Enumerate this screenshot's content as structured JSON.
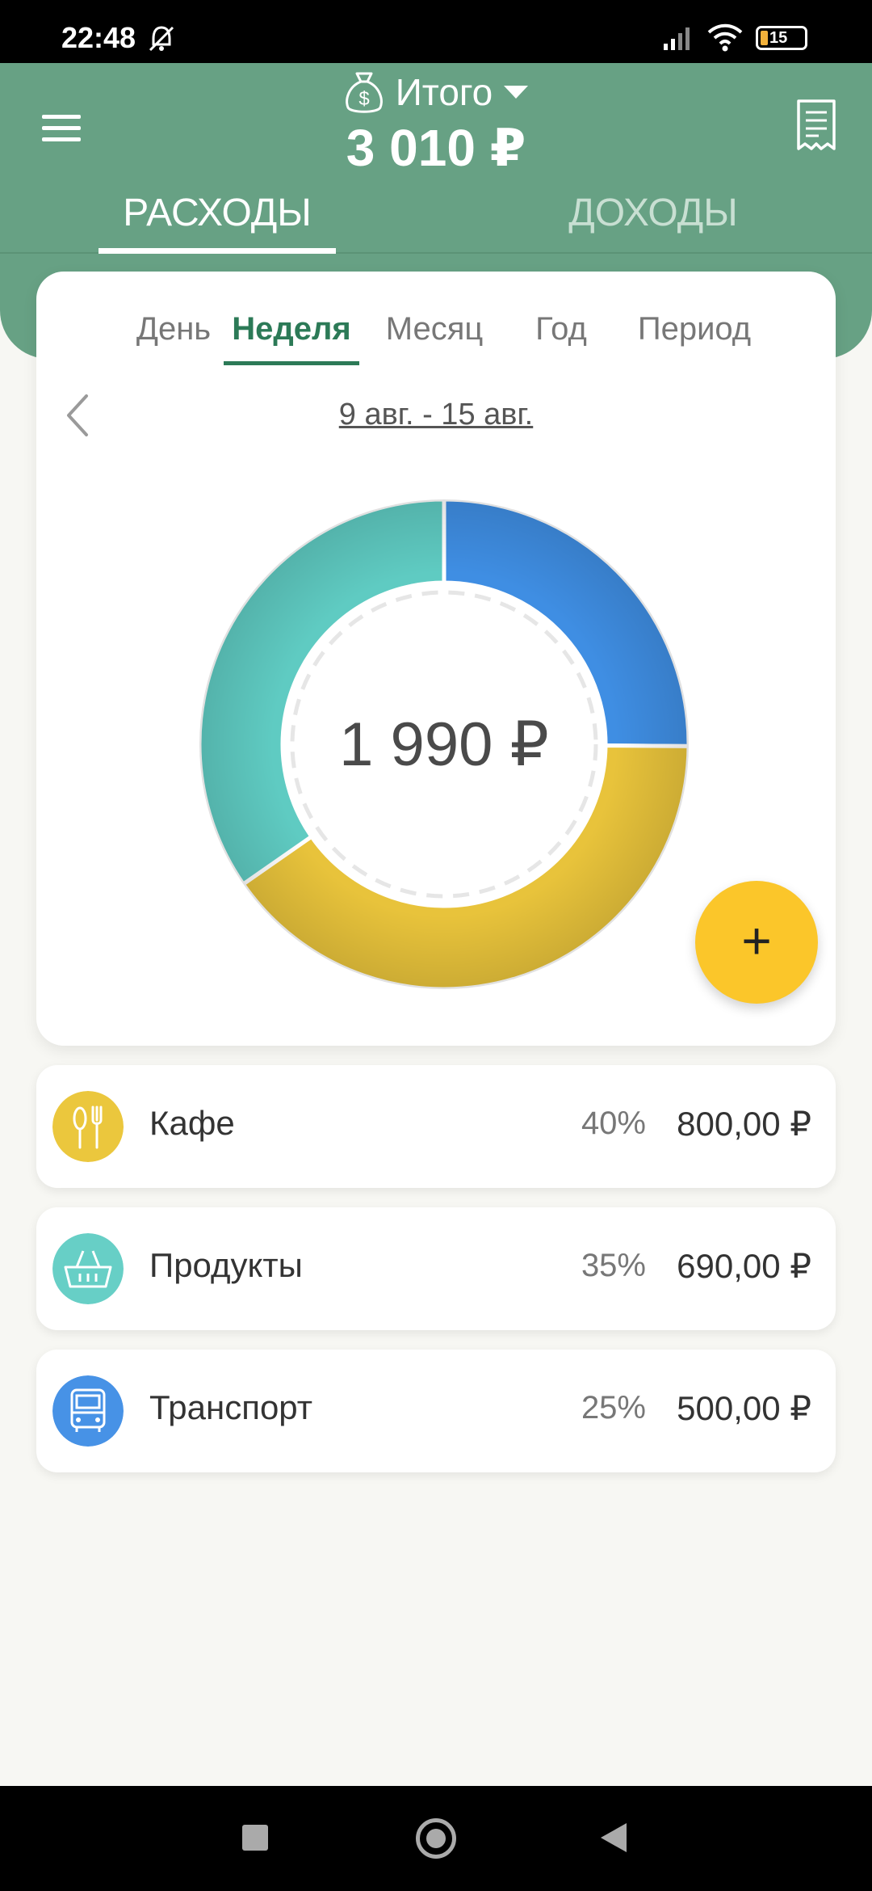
{
  "status_bar": {
    "time": "22:48",
    "battery": "15"
  },
  "header": {
    "wallet_title": "Итого",
    "total": "3 010 ₽",
    "tabs": {
      "expenses": "РАСХОДЫ",
      "income": "ДОХОДЫ"
    }
  },
  "period": {
    "tabs": [
      "День",
      "Неделя",
      "Месяц",
      "Год",
      "Период"
    ],
    "active": "Неделя",
    "range": "9 авг. - 15 авг."
  },
  "chart_data": {
    "type": "pie",
    "categories": [
      "Транспорт",
      "Кафе",
      "Продукты"
    ],
    "values": [
      500,
      800,
      690
    ],
    "colors": [
      "#3f8ee3",
      "#e8c33b",
      "#5fcbc2"
    ],
    "center_label": "1 990 ₽"
  },
  "fab": {
    "label": "+"
  },
  "categories": [
    {
      "name": "Кафе",
      "percent": "40%",
      "amount": "800,00 ₽",
      "icon": "fork-spoon-icon",
      "color": "#ebc73d"
    },
    {
      "name": "Продукты",
      "percent": "35%",
      "amount": "690,00 ₽",
      "icon": "grocery-basket-icon",
      "color": "#67cfc6"
    },
    {
      "name": "Транспорт",
      "percent": "25%",
      "amount": "500,00 ₽",
      "icon": "bus-icon",
      "color": "#4792e6"
    }
  ]
}
